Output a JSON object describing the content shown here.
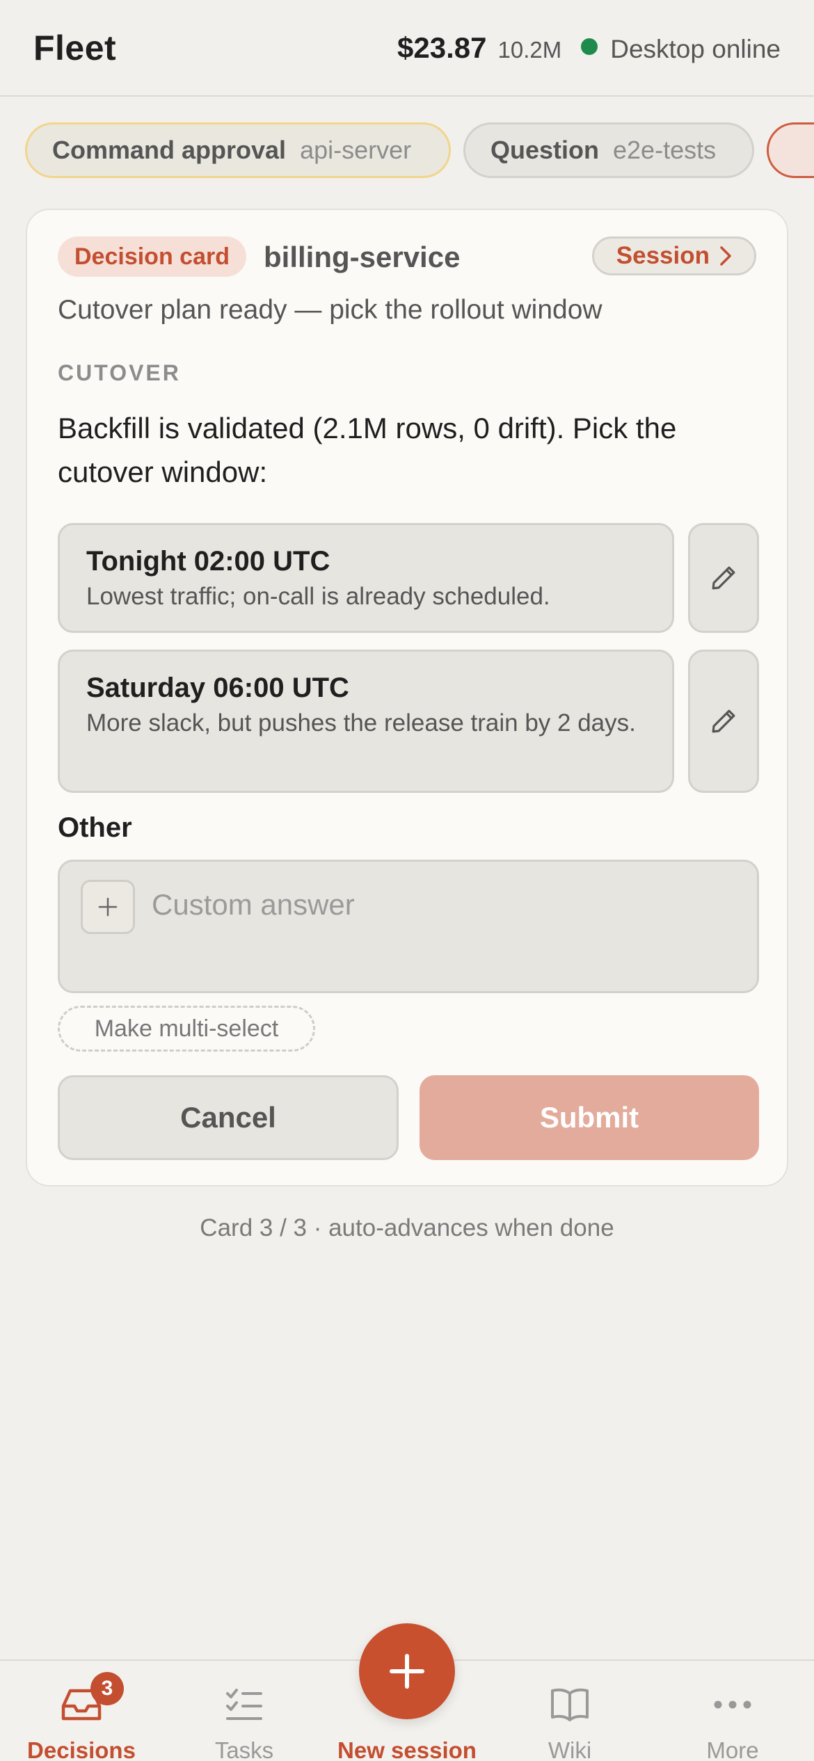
{
  "header": {
    "title": "Fleet",
    "cost": "$23.87",
    "tokens": "10.2M",
    "status": "Desktop online",
    "status_color": "#1e8a4c"
  },
  "queue": [
    {
      "kind": "Command approval",
      "target": "api-server"
    },
    {
      "kind": "Question",
      "target": "e2e-tests"
    }
  ],
  "card": {
    "badge": "Decision card",
    "project": "billing-service",
    "session_label": "Session",
    "subtitle": "Cutover plan ready — pick the rollout window",
    "section": "CUTOVER",
    "question": "Backfill is validated (2.1M rows, 0 drift). Pick the cutover window:",
    "options": [
      {
        "title": "Tonight 02:00 UTC",
        "desc": "Lowest traffic; on-call is already scheduled."
      },
      {
        "title": "Saturday 06:00 UTC",
        "desc": "More slack, but pushes the release train by 2 days."
      }
    ],
    "other_label": "Other",
    "custom_placeholder": "Custom answer",
    "multi_select_label": "Make multi-select",
    "cancel_label": "Cancel",
    "submit_label": "Submit"
  },
  "counter": "Card 3 / 3 · auto-advances when done",
  "nav": {
    "decisions": "Decisions",
    "decisions_badge": "3",
    "tasks": "Tasks",
    "new_session": "New session",
    "wiki": "Wiki",
    "more": "More"
  },
  "colors": {
    "accent": "#c34e30",
    "background": "#f1f0ec",
    "card": "#fbfaf7"
  }
}
